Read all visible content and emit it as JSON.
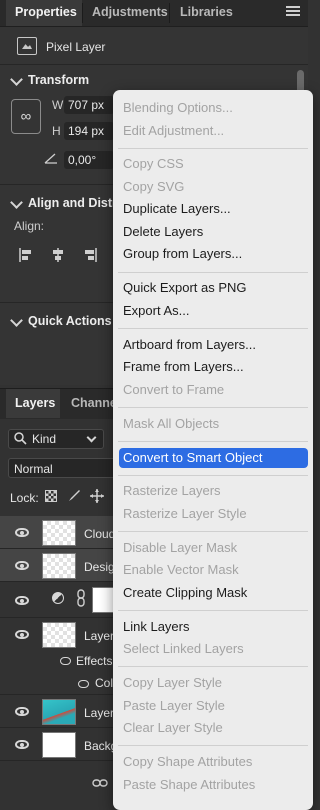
{
  "tabs": {
    "properties": "Properties",
    "adjustments": "Adjustments",
    "libraries": "Libraries"
  },
  "properties": {
    "layer_type": "Pixel Layer",
    "transform": {
      "title": "Transform",
      "w_label": "W",
      "w_value": "707 px",
      "h_label": "H",
      "h_value": "194 px",
      "angle_value": "0,00°"
    },
    "align": {
      "title": "Align and Distri",
      "label": "Align:"
    },
    "quick_actions": {
      "title": "Quick Actions"
    }
  },
  "layers_panel": {
    "tabs": {
      "layers": "Layers",
      "channels": "Channe"
    },
    "filter_kind": "Kind",
    "blend_mode": "Normal",
    "lock_label": "Lock:",
    "rows": [
      {
        "name": "Cloud",
        "thumb": "transparent"
      },
      {
        "name": "Desig",
        "thumb": "design"
      },
      {
        "name": "",
        "thumb": "white"
      },
      {
        "name": "Layer",
        "thumb": "transparent"
      },
      {
        "name": "Effects",
        "thumb": "none"
      },
      {
        "name": "Col",
        "thumb": "none"
      },
      {
        "name": "Layer",
        "thumb": "photo"
      },
      {
        "name": "Backg",
        "thumb": "white"
      }
    ]
  },
  "context_menu": {
    "groups": [
      [
        {
          "label": "Blending Options...",
          "enabled": false
        },
        {
          "label": "Edit Adjustment...",
          "enabled": false
        }
      ],
      [
        {
          "label": "Copy CSS",
          "enabled": false
        },
        {
          "label": "Copy SVG",
          "enabled": false
        },
        {
          "label": "Duplicate Layers...",
          "enabled": true
        },
        {
          "label": "Delete Layers",
          "enabled": true
        },
        {
          "label": "Group from Layers...",
          "enabled": true
        }
      ],
      [
        {
          "label": "Quick Export as PNG",
          "enabled": true
        },
        {
          "label": "Export As...",
          "enabled": true
        }
      ],
      [
        {
          "label": "Artboard from Layers...",
          "enabled": true
        },
        {
          "label": "Frame from Layers...",
          "enabled": true
        },
        {
          "label": "Convert to Frame",
          "enabled": false
        }
      ],
      [
        {
          "label": "Mask All Objects",
          "enabled": false
        }
      ],
      [
        {
          "label": "Convert to Smart Object",
          "enabled": true,
          "highlighted": true
        }
      ],
      [
        {
          "label": "Rasterize Layers",
          "enabled": false
        },
        {
          "label": "Rasterize Layer Style",
          "enabled": false
        }
      ],
      [
        {
          "label": "Disable Layer Mask",
          "enabled": false
        },
        {
          "label": "Enable Vector Mask",
          "enabled": false
        },
        {
          "label": "Create Clipping Mask",
          "enabled": true
        }
      ],
      [
        {
          "label": "Link Layers",
          "enabled": true
        },
        {
          "label": "Select Linked Layers",
          "enabled": false
        }
      ],
      [
        {
          "label": "Copy Layer Style",
          "enabled": false
        },
        {
          "label": "Paste Layer Style",
          "enabled": false
        },
        {
          "label": "Clear Layer Style",
          "enabled": false
        }
      ],
      [
        {
          "label": "Copy Shape Attributes",
          "enabled": false
        },
        {
          "label": "Paste Shape Attributes",
          "enabled": false
        }
      ]
    ]
  },
  "colors": {
    "highlight": "#2d6ce3",
    "panel_bg": "#323232",
    "menu_bg": "#ececec"
  }
}
